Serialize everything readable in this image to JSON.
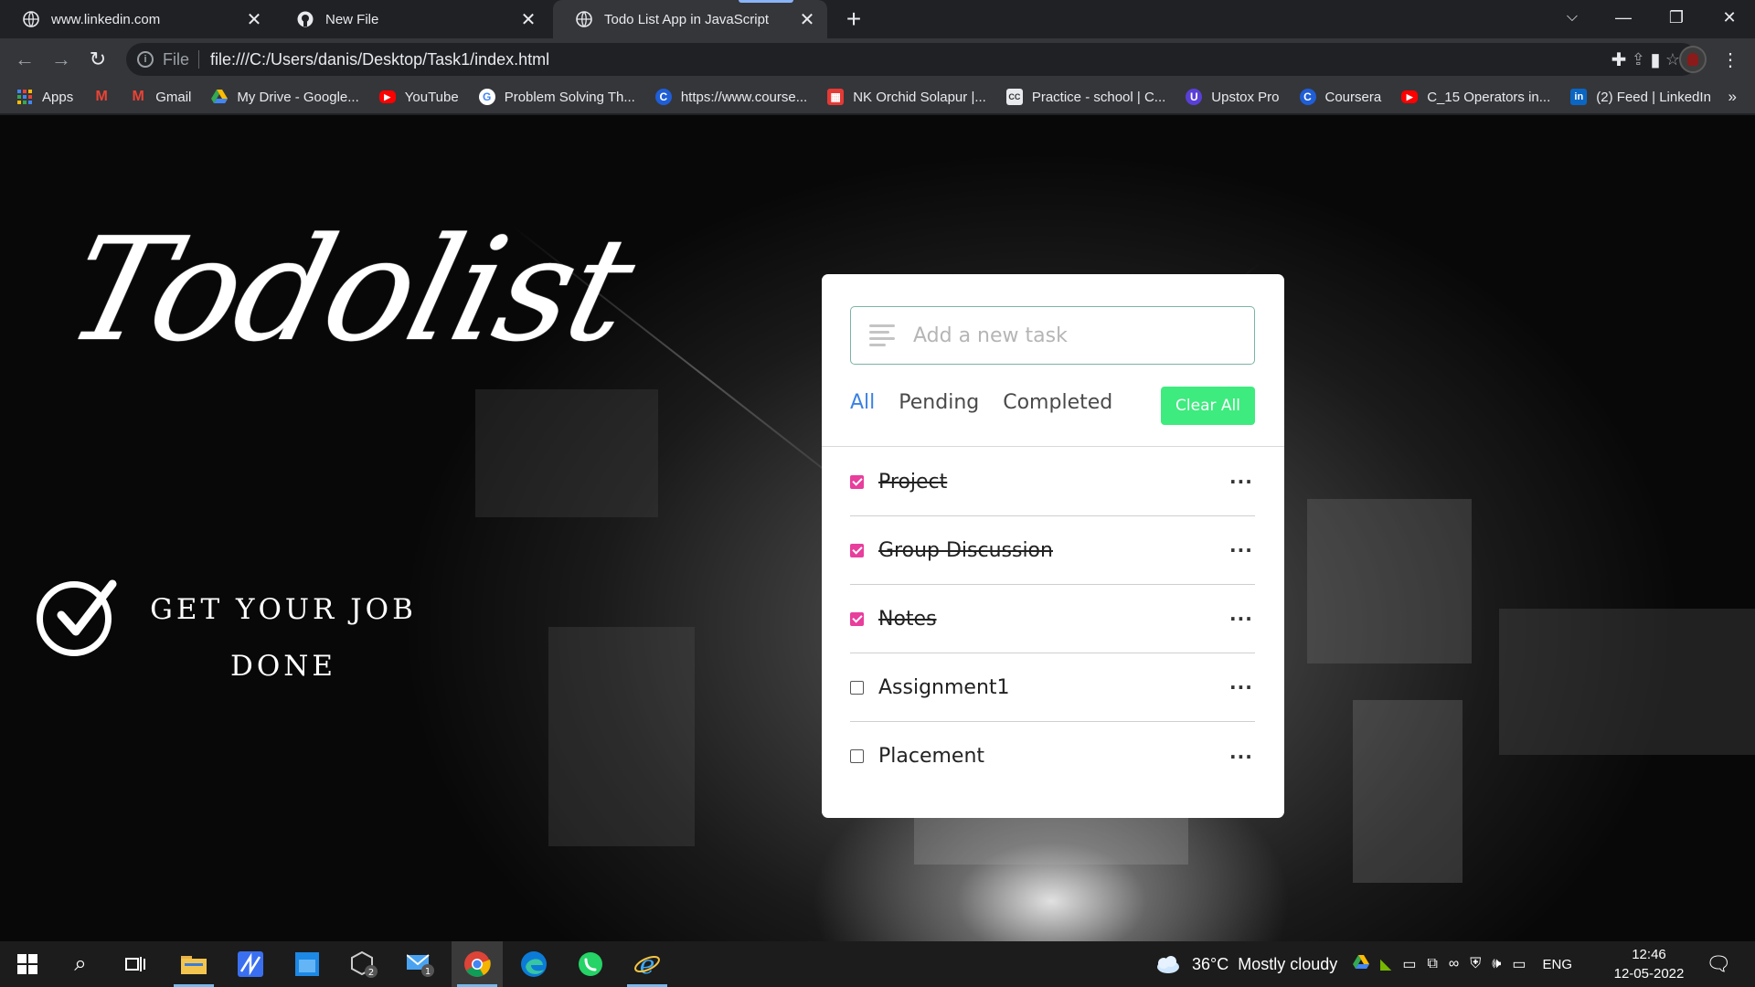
{
  "browser": {
    "tabs": [
      {
        "title": "www.linkedin.com",
        "icon": "globe-icon"
      },
      {
        "title": "New File",
        "icon": "github-icon"
      },
      {
        "title": "Todo List App in JavaScript",
        "icon": "globe-icon",
        "active": true
      }
    ],
    "url": {
      "scheme": "File",
      "path": "file:///C:/Users/danis/Desktop/Task1/index.html"
    },
    "bookmarks": [
      {
        "label": "Apps",
        "icon": "apps-grid-icon"
      },
      {
        "label": "",
        "icon": "gmail-icon"
      },
      {
        "label": "Gmail",
        "icon": "gmail-icon"
      },
      {
        "label": "My Drive - Google...",
        "icon": "google-drive-icon"
      },
      {
        "label": "YouTube",
        "icon": "youtube-icon"
      },
      {
        "label": "Problem Solving Th...",
        "icon": "google-icon"
      },
      {
        "label": "https://www.course...",
        "icon": "coursera-icon"
      },
      {
        "label": "NK Orchid Solapur |...",
        "icon": "nk-orchid-icon"
      },
      {
        "label": "Practice - school | C...",
        "icon": "cc-icon"
      },
      {
        "label": "Upstox Pro",
        "icon": "upstox-icon"
      },
      {
        "label": "Coursera",
        "icon": "coursera-icon"
      },
      {
        "label": "C_15 Operators in...",
        "icon": "youtube-icon"
      },
      {
        "label": "(2) Feed | LinkedIn",
        "icon": "linkedin-icon"
      }
    ],
    "more_bookmarks": "»"
  },
  "hero": {
    "logo_text": "Todolist",
    "tagline_line1": "GET YOUR JOB",
    "tagline_line2": "DONE"
  },
  "todo": {
    "input_placeholder": "Add a new task",
    "filters": [
      "All",
      "Pending",
      "Completed"
    ],
    "active_filter": "All",
    "clear_label": "Clear All",
    "menu_glyph": "···",
    "tasks": [
      {
        "label": "Project",
        "done": true
      },
      {
        "label": "Group Discussion",
        "done": true
      },
      {
        "label": "Notes",
        "done": true
      },
      {
        "label": "Assignment1",
        "done": false
      },
      {
        "label": "Placement",
        "done": false
      }
    ],
    "colors": {
      "accent": "#3c82e3",
      "clear_button": "#3eeb7e",
      "checked": "#e83e9c",
      "input_border": "#7ab3a7"
    }
  },
  "taskbar": {
    "weather": {
      "temp": "36°C",
      "condition": "Mostly cloudy"
    },
    "language": "ENG",
    "time": "12:46",
    "date": "12-05-2022",
    "badges": {
      "network_app": "2",
      "mail": "1"
    }
  }
}
